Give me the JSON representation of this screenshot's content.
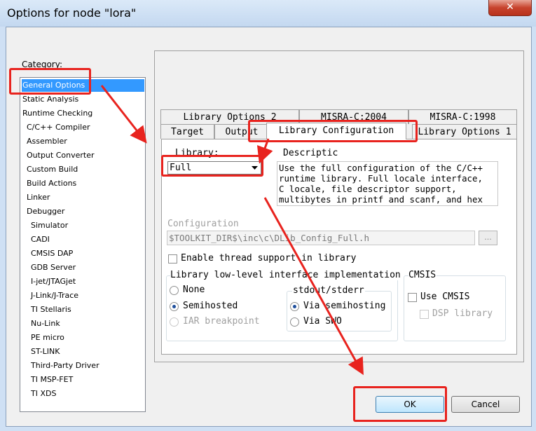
{
  "window": {
    "title": "Options for node \"lora\"",
    "close_glyph": "✕"
  },
  "category": {
    "label": "Category:",
    "items": [
      {
        "label": "General Options",
        "indent": 0,
        "selected": true
      },
      {
        "label": "Static Analysis",
        "indent": 0
      },
      {
        "label": "Runtime Checking",
        "indent": 0
      },
      {
        "label": "C/C++ Compiler",
        "indent": 1
      },
      {
        "label": "Assembler",
        "indent": 1
      },
      {
        "label": "Output Converter",
        "indent": 1
      },
      {
        "label": "Custom Build",
        "indent": 1
      },
      {
        "label": "Build Actions",
        "indent": 1
      },
      {
        "label": "Linker",
        "indent": 1
      },
      {
        "label": "Debugger",
        "indent": 1
      },
      {
        "label": "Simulator",
        "indent": 2
      },
      {
        "label": "CADI",
        "indent": 2
      },
      {
        "label": "CMSIS DAP",
        "indent": 2
      },
      {
        "label": "GDB Server",
        "indent": 2
      },
      {
        "label": "I-jet/JTAGjet",
        "indent": 2
      },
      {
        "label": "J-Link/J-Trace",
        "indent": 2
      },
      {
        "label": "TI Stellaris",
        "indent": 2
      },
      {
        "label": "Nu-Link",
        "indent": 2
      },
      {
        "label": "PE micro",
        "indent": 2
      },
      {
        "label": "ST-LINK",
        "indent": 2
      },
      {
        "label": "Third-Party Driver",
        "indent": 2
      },
      {
        "label": "TI MSP-FET",
        "indent": 2
      },
      {
        "label": "TI XDS",
        "indent": 2
      }
    ]
  },
  "tabs": {
    "row1": [
      "Library Options 2",
      "MISRA-C:2004",
      "MISRA-C:1998"
    ],
    "row2": [
      "Target",
      "Output",
      "Library Configuration",
      "Library Options 1"
    ],
    "active": "Library Configuration"
  },
  "library": {
    "label": "Library:",
    "value": "Full",
    "description_label": "Descriptic",
    "description_lines": [
      "Use the full configuration of the C/C++",
      "runtime library. Full locale interface,",
      "C locale, file descriptor support,",
      "multibytes in printf and scanf, and hex"
    ]
  },
  "configuration": {
    "label": "Configuration",
    "path": "$TOOLKIT_DIR$\\inc\\c\\DLib_Config_Full.h",
    "browse_label": "..."
  },
  "thread_support": {
    "label": "Enable thread support in library",
    "checked": false
  },
  "low_level": {
    "label": "Library low-level interface implementation",
    "options": [
      {
        "label": "None",
        "checked": false,
        "disabled": false
      },
      {
        "label": "Semihosted",
        "checked": true,
        "disabled": false
      },
      {
        "label": "IAR breakpoint",
        "checked": false,
        "disabled": true
      }
    ],
    "stdout": {
      "label": "stdout/stderr",
      "options": [
        {
          "label": "Via semihosting",
          "checked": true
        },
        {
          "label": "Via SWO",
          "checked": false
        }
      ]
    }
  },
  "cmsis": {
    "label": "CMSIS",
    "use_label": "Use CMSIS",
    "dsp_label": "DSP library"
  },
  "buttons": {
    "ok": "OK",
    "cancel": "Cancel"
  },
  "colors": {
    "annotation": "#e8231e",
    "selection": "#3399ff"
  }
}
